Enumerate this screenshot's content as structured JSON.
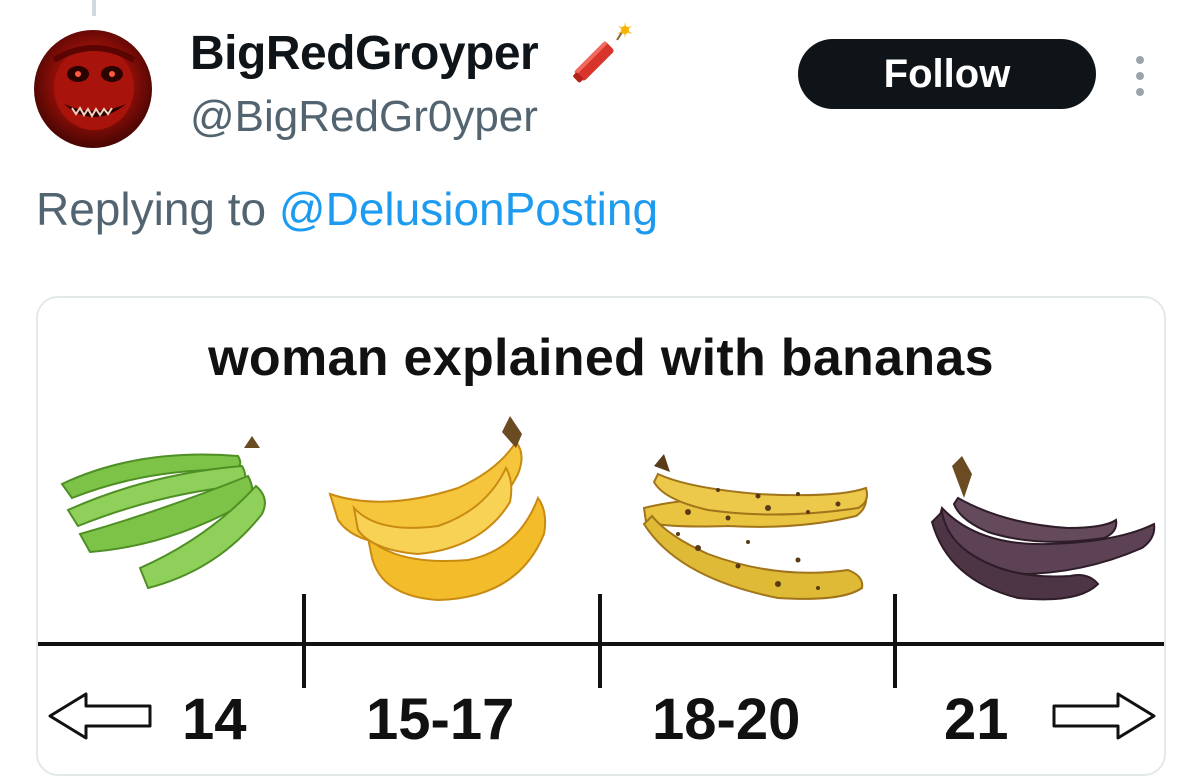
{
  "tweet": {
    "display_name": "BigRedGroyper",
    "handle": "@BigRedGr0yper",
    "follow_label": "Follow",
    "reply_prefix": "Replying to",
    "reply_to": "@DelusionPosting"
  },
  "media": {
    "title": "woman explained with bananas",
    "stages": [
      {
        "label": "14",
        "banana": "green"
      },
      {
        "label": "15-17",
        "banana": "yellow"
      },
      {
        "label": "18-20",
        "banana": "spotted"
      },
      {
        "label": "21",
        "banana": "brown"
      }
    ],
    "left_arrow_icon": "arrow-left-icon",
    "right_arrow_icon": "arrow-right-icon"
  },
  "colors": {
    "link": "#1d9bf0",
    "secondary_text": "#536471",
    "button_bg": "#0f1419"
  }
}
